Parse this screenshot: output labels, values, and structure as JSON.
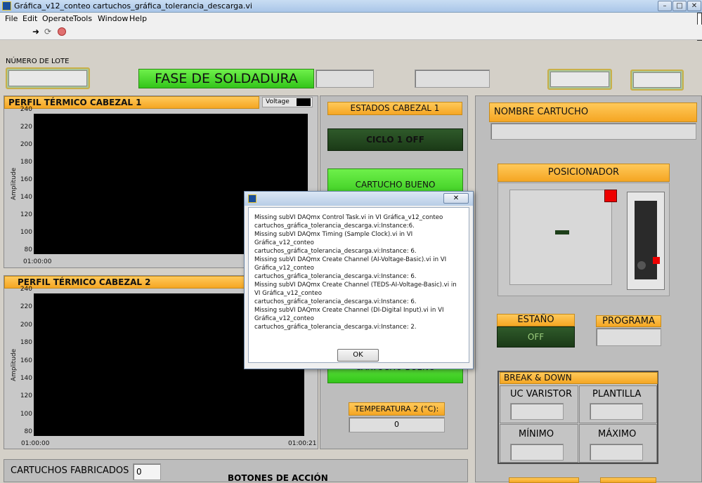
{
  "window": {
    "title": "Gráfica_v12_conteo cartuchos_gráfica_tolerancia_descarga.vi"
  },
  "menu": [
    "File",
    "Edit",
    "Operate",
    "Tools",
    "Window",
    "Help"
  ],
  "panel": {
    "lote_label": "NÚMERO DE LOTE",
    "fase": "FASE DE SOLDADURA",
    "graph1": {
      "title": "PERFIL TÉRMICO CABEZAL 1",
      "legend": "Voltage",
      "ylabel": "Amplitude",
      "yticks": [
        "240",
        "220",
        "200",
        "180",
        "160",
        "140",
        "120",
        "100",
        "80"
      ],
      "xstart": "01:00:00"
    },
    "graph2": {
      "title": "PERFIL TÉRMICO CABEZAL 2",
      "ylabel": "Amplitude",
      "yticks": [
        "240",
        "220",
        "200",
        "180",
        "160",
        "140",
        "120",
        "100",
        "80"
      ],
      "xstart": "01:00:00",
      "xend": "01:00:21"
    },
    "estados_title": "ESTADOS CABEZAL 1",
    "ciclo": "CICLO 1 OFF",
    "cartucho_bueno": "CARTUCHO BUENO",
    "cartucho_bueno_2": "CARTUCHO BUENO",
    "temp2_label": "TEMPERATURA 2 (°C):",
    "temp2_value": "0",
    "nombre_cartucho": "NOMBRE CARTUCHO",
    "posicionador": "POSICIONADOR",
    "estano": "ESTAÑO",
    "estano_state": "OFF",
    "programa": "PROGRAMA",
    "break_down": "BREAK & DOWN",
    "uc_varistor": "UC VARISTOR",
    "plantilla": "PLANTILLA",
    "minimo": "MÍNIMO",
    "maximo": "MÁXIMO",
    "cartuchos_label": "CARTUCHOS FABRICADOS",
    "cartuchos_value": "0",
    "botones": "BOTONES DE ACCIÓN"
  },
  "dialog": {
    "messages": [
      "Missing subVI DAQmx Control Task.vi in VI Gráfica_v12_conteo cartuchos_gráfica_tolerancia_descarga.vi:Instance:6.",
      "Missing subVI DAQmx Timing (Sample Clock).vi in VI Gráfica_v12_conteo cartuchos_gráfica_tolerancia_descarga.vi:Instance: 6.",
      "Missing subVI DAQmx Create Channel (AI-Voltage-Basic).vi in VI Gráfica_v12_conteo cartuchos_gráfica_tolerancia_descarga.vi:Instance: 6.",
      "Missing subVI DAQmx Create Channel (TEDS-AI-Voltage-Basic).vi in VI Gráfica_v12_conteo cartuchos_gráfica_tolerancia_descarga.vi:Instance: 6.",
      "Missing subVI DAQmx Create Channel (DI-Digital Input).vi in VI Gráfica_v12_conteo cartuchos_gráfica_tolerancia_descarga.vi:Instance: 2."
    ],
    "ok": "OK"
  }
}
